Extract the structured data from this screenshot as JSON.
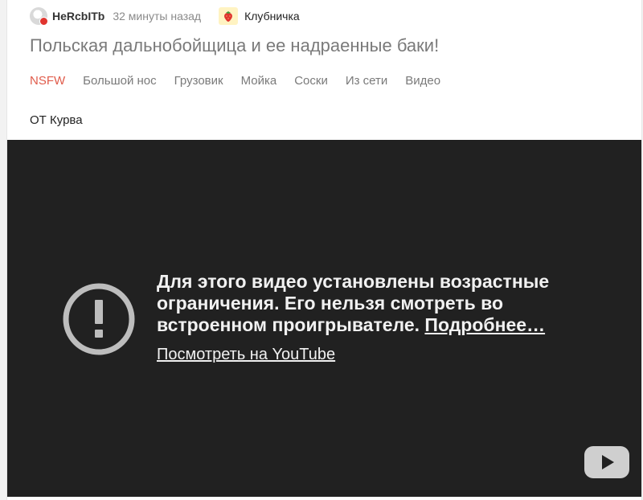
{
  "post": {
    "author": "HeRcbITb",
    "time": "32 минуты назад",
    "community": "Клубничка",
    "title": "Польская дальнобойщица и ее надраенные баки!",
    "tags": [
      "NSFW",
      "Большой нос",
      "Грузовик",
      "Мойка",
      "Соски",
      "Из сети",
      "Видео"
    ],
    "body_text": "ОТ Курва"
  },
  "video": {
    "message": "Для этого видео установлены возрастные ограничения. Его нельзя смотреть во встроенном проигрывателе.",
    "more_link": "Подробнее…",
    "watch_link": "Посмотреть на YouTube"
  },
  "icons": {
    "avatar": "avatar-icon",
    "community": "strawberry-icon",
    "warning": "exclamation-circle-icon",
    "youtube": "youtube-play-icon"
  },
  "colors": {
    "nsfw": "#e05c4b",
    "player_bg": "#212121",
    "strawberry": "#e0342f"
  }
}
